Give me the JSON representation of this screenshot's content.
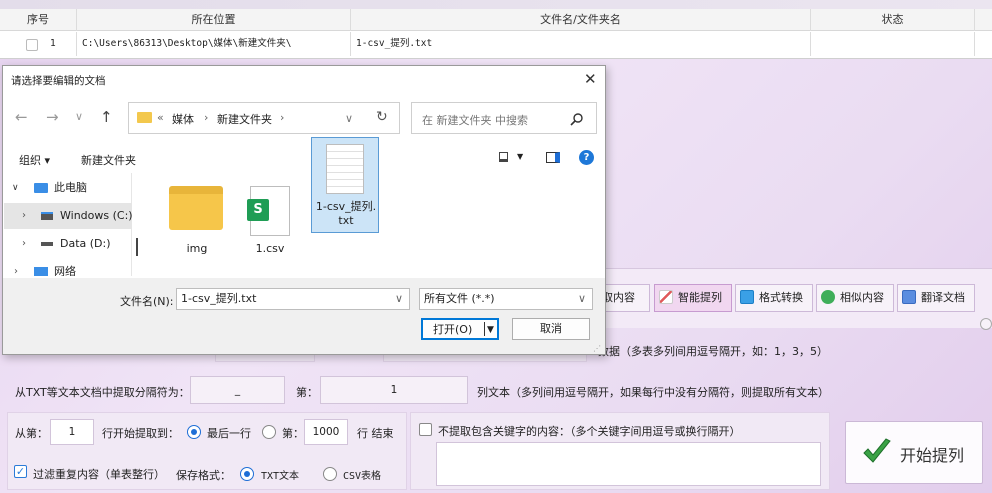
{
  "table": {
    "headers": [
      "序号",
      "所在位置",
      "文件名/文件夹名",
      "状态"
    ],
    "row": {
      "index": "1",
      "location": "C:\\Users\\86313\\Desktop\\媒体\\新建文件夹\\",
      "filename": "1-csv_提列.txt",
      "status": ""
    }
  },
  "toolbar": {
    "items": [
      "取内容",
      "智能提列",
      "格式转换",
      "相似内容",
      "翻译文档"
    ]
  },
  "dialog": {
    "title": "请选择要编辑的文档",
    "breadcrumb": [
      "«",
      "媒体",
      "›",
      "新建文件夹",
      "›"
    ],
    "search_placeholder": "在 新建文件夹 中搜索",
    "organize": "组织 ▾",
    "new_folder": "新建文件夹",
    "sidebar": [
      "此电脑",
      "Windows (C:)",
      "Data (D:)",
      "网络"
    ],
    "files": [
      {
        "name": "img",
        "icon": "folder-icon"
      },
      {
        "name": "1.csv",
        "icon": "spreadsheet-icon"
      },
      {
        "name": "1-csv_提列.\ntxt",
        "icon": "text-file-icon"
      }
    ],
    "filename_label": "文件名(N):",
    "filename_value": "1-csv_提列.txt",
    "filetype_value": "所有文件 (*.*)",
    "open_label": "打开(O)",
    "cancel_label": "取消"
  },
  "form": {
    "col_hint": "数据（多表多列间用逗号隔开，如：1，3，5）",
    "sep_label": "从TXT等文本文档中提取分隔符为：",
    "sep_value": "_",
    "nth_label": "第：",
    "nth_value": "1",
    "col_text_hint": "列文本（多列间用逗号隔开，如果每行中没有分隔符，则提取所有文本）",
    "from_label": "从第：",
    "from_value": "1",
    "row_start_label": "行开始提取到：",
    "last_row_label": "最后一行",
    "nth_row_label": "第：",
    "nth_row_value": "1000",
    "end_label": "行 结束",
    "exclude_label": "不提取包含关键字的内容：（多个关键字间用逗号或换行隔开）",
    "dedupe_label": "过滤重复内容（单表整行）",
    "save_format_label": "保存格式：",
    "txt_label": "TXT文本",
    "csv_label": "CSV表格",
    "start_label": "开始提列"
  }
}
